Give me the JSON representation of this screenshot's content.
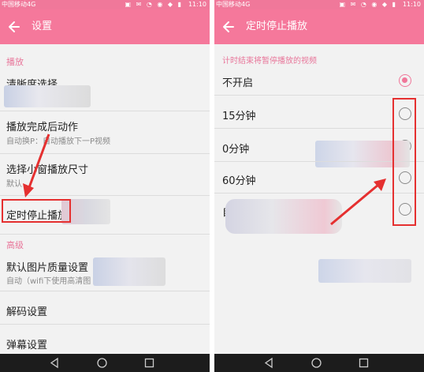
{
  "left_screen": {
    "status_bar": {
      "carrier": "中国移动4G",
      "time": "11:10"
    },
    "app_bar": {
      "title": "设置"
    },
    "sections": [
      {
        "label": "播放"
      },
      {
        "label": "高级"
      }
    ],
    "items": [
      {
        "title": "清晰度选择",
        "subtitle": ""
      },
      {
        "title": "播放完成后动作",
        "subtitle": "自动换P：自动播放下一P视频"
      },
      {
        "title": "选择小窗播放尺寸",
        "subtitle": "默认"
      },
      {
        "title": "定时停止播放",
        "subtitle": ""
      },
      {
        "title": "默认图片质量设置",
        "subtitle": "自动（wifi下使用高清图"
      },
      {
        "title": "解码设置",
        "subtitle": ""
      },
      {
        "title": "弹幕设置",
        "subtitle": ""
      }
    ]
  },
  "right_screen": {
    "status_bar": {
      "carrier": "中国移动4G",
      "time": "11:10"
    },
    "app_bar": {
      "title": "定时停止播放"
    },
    "section_label": "计时结束将暂停播放的视频",
    "options": [
      {
        "label": "不开启",
        "selected": true
      },
      {
        "label": "15分钟",
        "selected": false
      },
      {
        "label": "0分钟",
        "selected": false
      },
      {
        "label": "60分钟",
        "selected": false
      },
      {
        "label": "自",
        "selected": false
      }
    ]
  },
  "colors": {
    "accent": "#f5789b",
    "highlight_box": "#e53030",
    "annotation_arrow": "#e53030"
  },
  "icons": [
    "back-arrow-icon",
    "nav-back-icon",
    "nav-home-icon",
    "nav-recents-icon",
    "radio-button"
  ]
}
